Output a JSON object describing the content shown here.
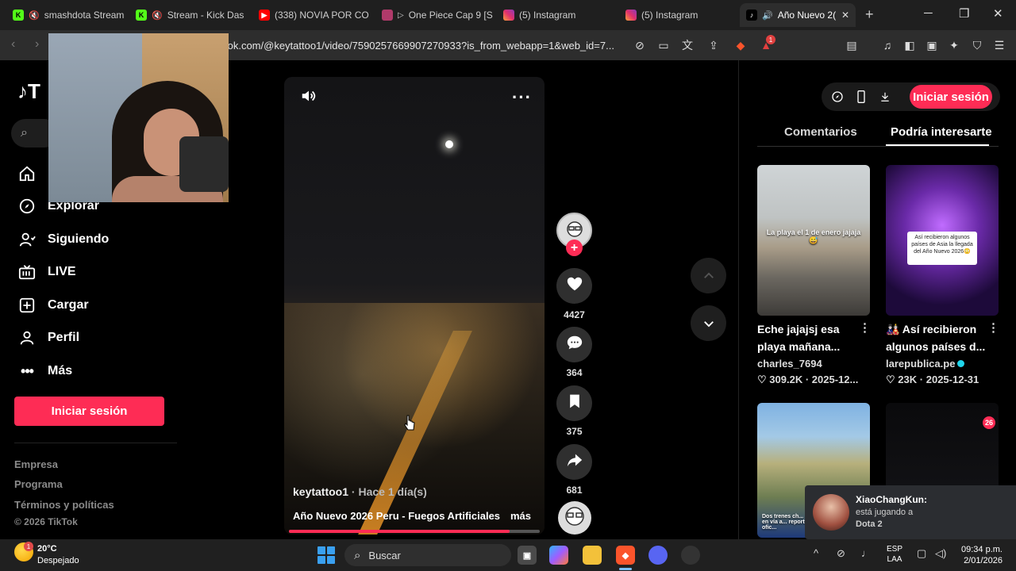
{
  "browser": {
    "tabs": [
      {
        "title": "smashdota Stream",
        "icon": "kick-icon",
        "color": "#53fc18"
      },
      {
        "title": "Stream - Kick Das",
        "icon": "kick-icon",
        "color": "#53fc18"
      },
      {
        "title": "(338) NOVIA POR CO",
        "icon": "youtube-icon",
        "color": "#ff0000"
      },
      {
        "title": "One Piece Cap 9 [S",
        "icon": "anime-site-icon",
        "color": "#b03a6a"
      },
      {
        "title": "(5) Instagram",
        "icon": "instagram-icon",
        "color": "#e1306c"
      },
      {
        "title": "(5) Instagram",
        "icon": "instagram-icon",
        "color": "#e1306c"
      },
      {
        "title": "Año Nuevo 2(",
        "icon": "tiktok-icon",
        "color": "#ffffff"
      }
    ],
    "url": "tiktok.com/@keytattoo1/video/7590257669907270933?is_from_webapp=1&web_id=7...",
    "extension_badge": "1"
  },
  "left_nav": {
    "logo": "TikTok",
    "items": [
      {
        "label": "Explorar",
        "icon": "compass-icon"
      },
      {
        "label": "Siguiendo",
        "icon": "following-icon"
      },
      {
        "label": "LIVE",
        "icon": "live-icon"
      },
      {
        "label": "Cargar",
        "icon": "upload-icon"
      },
      {
        "label": "Perfil",
        "icon": "profile-icon"
      },
      {
        "label": "Más",
        "icon": "more-dots-icon"
      }
    ],
    "login_label": "Iniciar sesión",
    "footer": [
      "Empresa",
      "Programa",
      "Términos y políticas",
      "© 2026 TikTok"
    ]
  },
  "video": {
    "username": "keytattoo1",
    "time_ago": " · Hace 1 día(s)",
    "description": "Año Nuevo 2026 Peru - Fuegos Artificiales",
    "more_label": "más",
    "progress": 0.88,
    "likes": "4427",
    "comments": "364",
    "saves": "375",
    "shares": "681"
  },
  "right_panel": {
    "login_label": "Iniciar sesión",
    "tabs": [
      "Comentarios",
      "Podría interesarte"
    ],
    "active_tab": "Podría interesarte",
    "cards": [
      {
        "title": "Eche jajajsj esa playa mañana...",
        "author": "charles_7694",
        "likes": "309.2K",
        "date": "2025-12...",
        "caption": "La playa el 1 de enero jajaja 😅"
      },
      {
        "title": "🎎 Así recibieron algunos países d...",
        "author": "larepublica.pe",
        "likes": "23K",
        "date": "2025-12-31",
        "caption": "Así recibieron algunos países de Asia la llegada del Año Nuevo 2026😳"
      },
      {
        "title": "",
        "author": "",
        "likes": "",
        "date": "",
        "caption": "Dos trenes ch... en vía a... reporte ofic..."
      },
      {
        "title": "",
        "author": "",
        "likes": "",
        "date": "",
        "caption": "26"
      }
    ]
  },
  "toast": {
    "name": "XiaoChangKun:",
    "line1": "está jugando a",
    "line2": "Dota 2"
  },
  "taskbar": {
    "temperature": "20°C",
    "weather": "Despejado",
    "weather_badge": "1",
    "search_placeholder": "Buscar",
    "language_top": "ESP",
    "language_bottom": "LAA",
    "time": "09:34 p.m.",
    "date": "2/01/2026"
  }
}
